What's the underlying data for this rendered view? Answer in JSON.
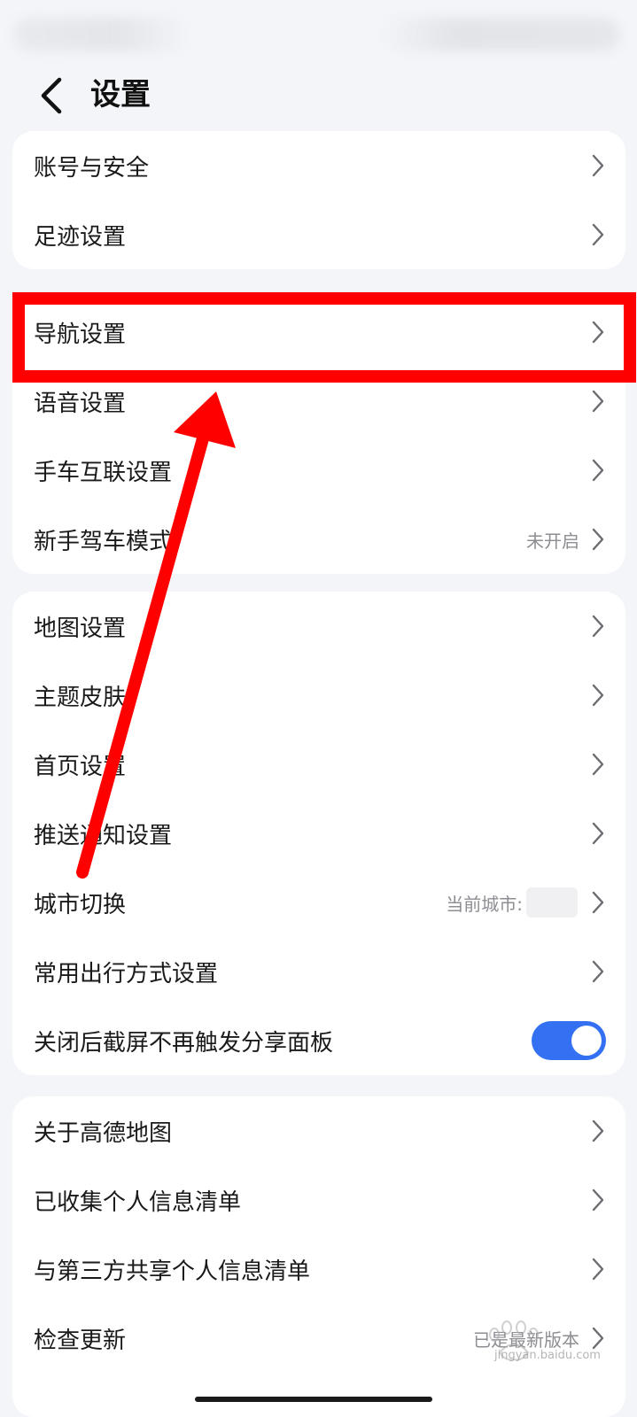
{
  "header": {
    "title": "设置"
  },
  "group1": [
    {
      "label": "账号与安全"
    },
    {
      "label": "足迹设置"
    }
  ],
  "group2": [
    {
      "label": "导航设置"
    },
    {
      "label": "语音设置"
    },
    {
      "label": "手车互联设置"
    },
    {
      "label": "新手驾车模式",
      "value": "未开启"
    }
  ],
  "group3": [
    {
      "label": "地图设置"
    },
    {
      "label": "主题皮肤"
    },
    {
      "label": "首页设置"
    },
    {
      "label": "推送通知设置"
    },
    {
      "label": "城市切换",
      "value": "当前城市:"
    },
    {
      "label": "常用出行方式设置"
    },
    {
      "label": "关闭后截屏不再触发分享面板",
      "toggle_on": true
    }
  ],
  "group4": [
    {
      "label": "关于高德地图"
    },
    {
      "label": "已收集个人信息清单"
    },
    {
      "label": "与第三方共享个人信息清单"
    },
    {
      "label": "检查更新",
      "value": "已是最新版本"
    }
  ],
  "annotation": {
    "highlight_color": "#ff0000",
    "highlighted_item": "导航设置"
  },
  "watermark": {
    "text": "jingyan.baidu.com"
  },
  "colors": {
    "toggle_on": "#3371f2",
    "background": "#f4f5f9",
    "card": "#ffffff"
  }
}
